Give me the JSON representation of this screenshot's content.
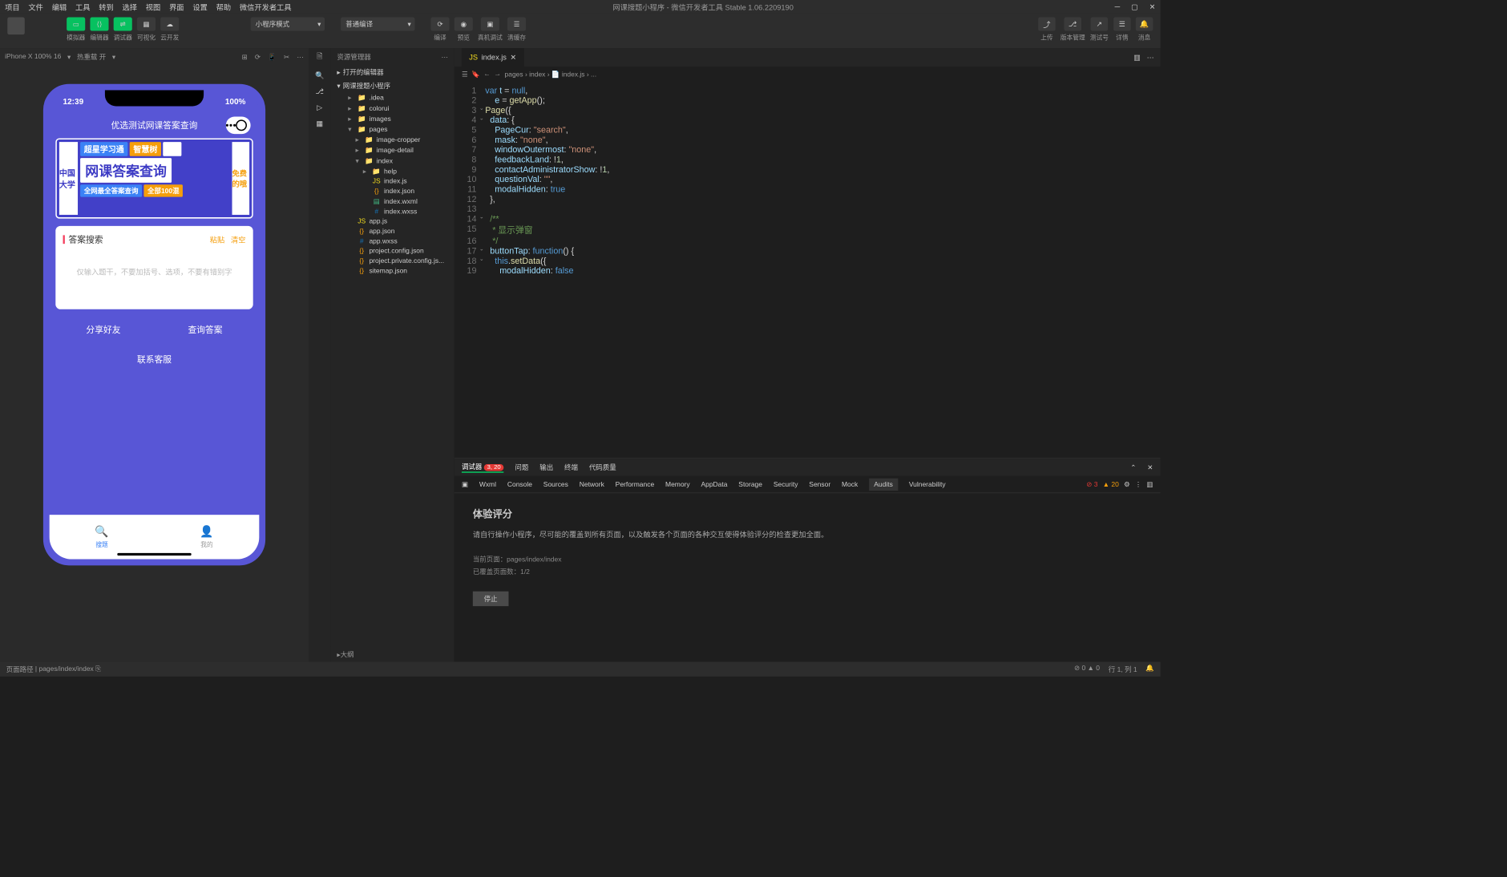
{
  "menubar": [
    "项目",
    "文件",
    "编辑",
    "工具",
    "转到",
    "选择",
    "视图",
    "界面",
    "设置",
    "帮助",
    "微信开发者工具"
  ],
  "window_title": "网课搜题小程序 - 微信开发者工具 Stable 1.06.2209190",
  "toolbar": {
    "sim_label": "模拟器",
    "editor_label": "编辑器",
    "debug_label": "调试器",
    "visual_label": "可视化",
    "cloud_label": "云开发",
    "mode": "小程序模式",
    "compile": "普通编译",
    "compile_label": "编译",
    "preview_label": "预览",
    "real_label": "真机调试",
    "clear_label": "清缓存",
    "upload_label": "上传",
    "version_label": "版本管理",
    "test_label": "测试号",
    "details_label": "详情",
    "message_label": "消息"
  },
  "simulator": {
    "device": "iPhone X 100% 16",
    "hot": "热重载 开",
    "time": "12:39",
    "battery": "100%",
    "app_title": "优选测试网课答案查询",
    "banner_left": "中国大学",
    "chips": {
      "a": "超星学习通",
      "b": "智慧树",
      "c": "网课答案查询",
      "d": "全网最全答案查询",
      "e": "全部100混"
    },
    "banner_right": "免费的哦",
    "search_title": "答案搜索",
    "paste": "粘贴",
    "clear": "清空",
    "placeholder": "仅输入题干，不要加括号、选项，不要有错别字",
    "btn_share": "分享好友",
    "btn_query": "查询答案",
    "btn_contact": "联系客服",
    "tab_search": "搜题",
    "tab_mine": "我的"
  },
  "explorer": {
    "title": "资源管理器",
    "open_editors": "打开的编辑器",
    "project": "网课搜题小程序",
    "tree": [
      ".idea",
      "colorui",
      "images",
      "pages",
      "image-cropper",
      "image-detail",
      "index",
      "help",
      "index.js",
      "index.json",
      "index.wxml",
      "index.wxss",
      "app.js",
      "app.json",
      "app.wxss",
      "project.config.json",
      "project.private.config.js...",
      "sitemap.json"
    ],
    "outline": "大纲"
  },
  "editor": {
    "tab": "index.js",
    "breadcrumb": "pages › index › 📄 index.js › ...",
    "lines": [
      {
        "n": 1,
        "h": "<span class='kw'>var</span> <span class='prop'>t</span> <span class='pun'>=</span> <span class='kw'>null</span><span class='pun'>,</span>"
      },
      {
        "n": 2,
        "h": "    <span class='prop'>e</span> <span class='pun'>=</span> <span class='fn'>getApp</span><span class='pun'>();</span>"
      },
      {
        "n": 3,
        "h": "<span class='fn'>Page</span><span class='pun'>({</span>",
        "fold": "⌄"
      },
      {
        "n": 4,
        "h": "  <span class='prop'>data</span><span class='pun'>: {</span>",
        "fold": "⌄"
      },
      {
        "n": 5,
        "h": "    <span class='prop'>PageCur</span><span class='pun'>:</span> <span class='str'>\"search\"</span><span class='pun'>,</span>"
      },
      {
        "n": 6,
        "h": "    <span class='prop'>mask</span><span class='pun'>:</span> <span class='str'>\"none\"</span><span class='pun'>,</span>"
      },
      {
        "n": 7,
        "h": "    <span class='prop'>windowOutermost</span><span class='pun'>:</span> <span class='str'>\"none\"</span><span class='pun'>,</span>"
      },
      {
        "n": 8,
        "h": "    <span class='prop'>feedbackLand</span><span class='pun'>:</span> <span class='pun'>!</span><span class='num'>1</span><span class='pun'>,</span>"
      },
      {
        "n": 9,
        "h": "    <span class='prop'>contactAdministratorShow</span><span class='pun'>:</span> <span class='pun'>!</span><span class='num'>1</span><span class='pun'>,</span>"
      },
      {
        "n": 10,
        "h": "    <span class='prop'>questionVal</span><span class='pun'>:</span> <span class='str'>\"\"</span><span class='pun'>,</span>"
      },
      {
        "n": 11,
        "h": "    <span class='prop'>modalHidden</span><span class='pun'>:</span> <span class='bool'>true</span>"
      },
      {
        "n": 12,
        "h": "  <span class='pun'>},</span>"
      },
      {
        "n": 13,
        "h": ""
      },
      {
        "n": 14,
        "h": "  <span class='cmt'>/**</span>",
        "fold": "⌄"
      },
      {
        "n": 15,
        "h": "   <span class='cmt'>* 显示弹窗</span>"
      },
      {
        "n": 16,
        "h": "   <span class='cmt'>*/</span>"
      },
      {
        "n": 17,
        "h": "  <span class='prop'>buttonTap</span><span class='pun'>:</span> <span class='kw'>function</span><span class='pun'>() {</span>",
        "fold": "⌄"
      },
      {
        "n": 18,
        "h": "    <span class='this'>this</span><span class='pun'>.</span><span class='fn'>setData</span><span class='pun'>({</span>",
        "fold": "⌄"
      },
      {
        "n": 19,
        "h": "      <span class='prop'>modalHidden</span><span class='pun'>:</span> <span class='bool'>false</span>"
      }
    ]
  },
  "devtools": {
    "tabs1": [
      "调试器",
      "问题",
      "输出",
      "终端",
      "代码质量"
    ],
    "badge1": "3, 20",
    "tabs2": [
      "Wxml",
      "Console",
      "Sources",
      "Network",
      "Performance",
      "Memory",
      "AppData",
      "Storage",
      "Security",
      "Sensor",
      "Mock",
      "Audits",
      "Vulnerability"
    ],
    "err": "3",
    "warn": "20",
    "title": "体验评分",
    "desc": "请自行操作小程序，尽可能的覆盖到所有页面，以及触发各个页面的各种交互使得体验评分的检查更加全面。",
    "meta1": "当前页面：pages/index/index",
    "meta2": "已覆盖页面数：1/2",
    "stop": "停止"
  },
  "status": {
    "page_path": "页面路径",
    "path": "pages/index/index",
    "problems": "⊘ 0 ▲ 0",
    "cursor": "行 1, 列 1"
  }
}
